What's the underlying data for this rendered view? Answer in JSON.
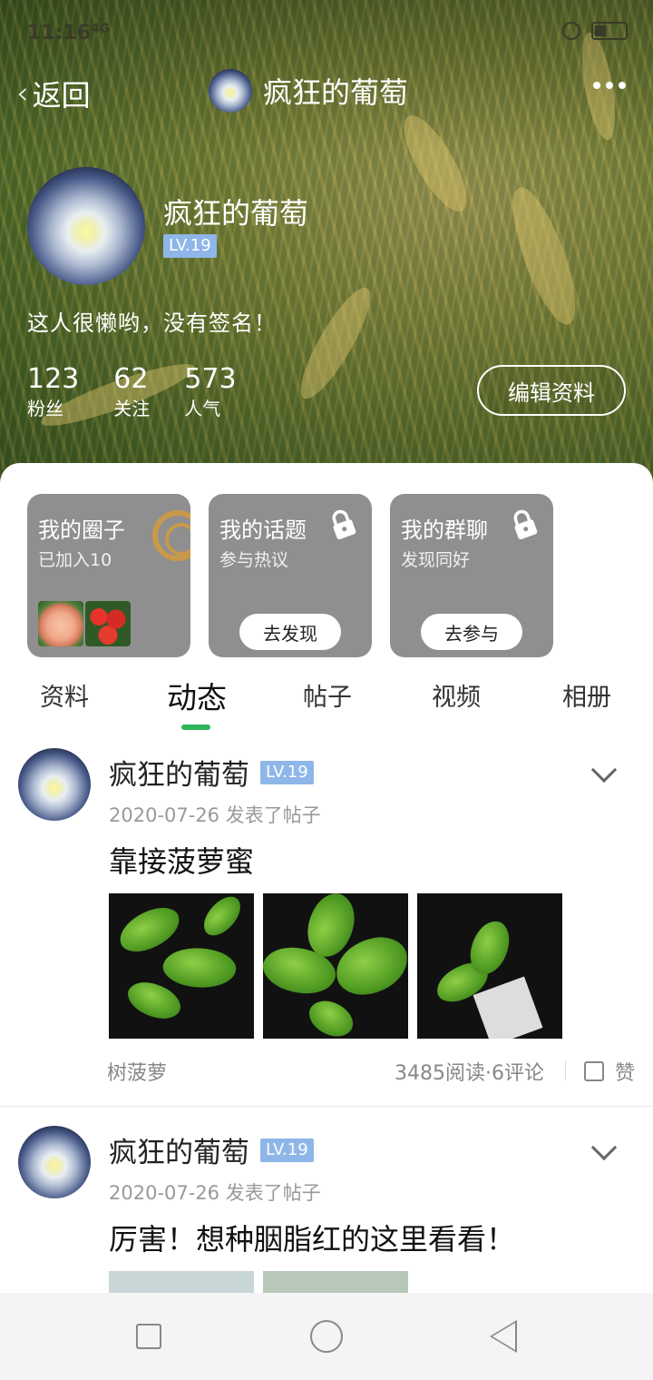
{
  "status_bar": {
    "time": "11:16",
    "signal": "4G",
    "network": "HD"
  },
  "nav": {
    "back_label": "返回",
    "title": "疯狂的葡萄",
    "more_icon": "more-dots-icon"
  },
  "profile": {
    "name": "疯狂的葡萄",
    "level": "LV.19",
    "signature": "这人很懒哟，没有签名！",
    "stats": [
      {
        "value": "123",
        "label": "粉丝"
      },
      {
        "value": "62",
        "label": "关注"
      },
      {
        "value": "573",
        "label": "人气"
      }
    ],
    "edit_label": "编辑资料"
  },
  "cards": [
    {
      "title": "我的圈子",
      "subtitle": "已加入10",
      "button": ""
    },
    {
      "title": "我的话题",
      "subtitle": "参与热议",
      "button": "去发现"
    },
    {
      "title": "我的群聊",
      "subtitle": "发现同好",
      "button": "去参与"
    }
  ],
  "tabs": [
    "资料",
    "动态",
    "帖子",
    "视频",
    "相册"
  ],
  "active_tab": "动态",
  "posts": [
    {
      "author": "疯狂的葡萄",
      "level": "LV.19",
      "meta": "2020-07-26 发表了帖子",
      "title": "靠接菠萝蜜",
      "tag": "树菠萝",
      "stats": "3485阅读·6评论",
      "like": "赞"
    },
    {
      "author": "疯狂的葡萄",
      "level": "LV.19",
      "meta": "2020-07-26 发表了帖子",
      "title": "厉害！想种胭脂红的这里看看！"
    }
  ],
  "colors": {
    "accent": "#2fb45a",
    "level_badge": "#8fb6e8",
    "card_bg": "#8f8f8f"
  }
}
